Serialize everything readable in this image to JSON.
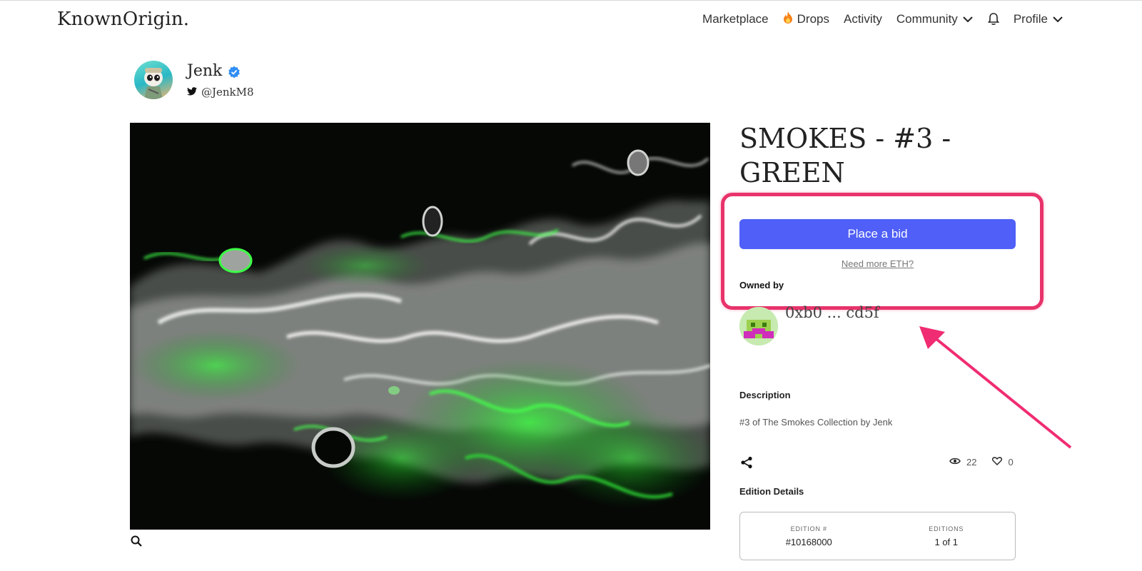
{
  "header": {
    "logo": "KnownOrigin.",
    "nav": {
      "marketplace": "Marketplace",
      "drops": "Drops",
      "activity": "Activity",
      "community": "Community",
      "profile": "Profile"
    }
  },
  "artist": {
    "name": "Jenk",
    "twitter": "@JenkM8"
  },
  "artwork": {
    "title": "SMOKES - #3 - GREEN"
  },
  "actions": {
    "bid_label": "Place a bid",
    "need_eth": "Need more ETH?"
  },
  "owner": {
    "label": "Owned by",
    "address": "0xb0 ... cd5f"
  },
  "description": {
    "label": "Description",
    "text": "#3 of The Smokes Collection by Jenk"
  },
  "stats": {
    "views": "22",
    "likes": "0"
  },
  "edition": {
    "label": "Edition Details",
    "edition_num_header": "EDITION #",
    "edition_num": "#10168000",
    "editions_header": "EDITIONS",
    "editions": "1 of 1"
  },
  "colors": {
    "accent": "#4f5ff7",
    "highlight": "#e8336b"
  }
}
